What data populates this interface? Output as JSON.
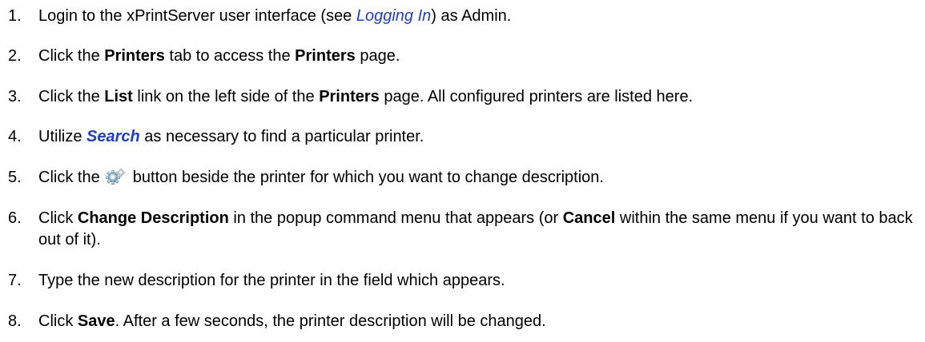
{
  "steps": [
    {
      "num": "1.",
      "t1": "Login to the xPrintServer user interface (see ",
      "link": "Logging In",
      "t2": ") as Admin."
    },
    {
      "num": "2.",
      "t1": "Click the ",
      "b1": "Printers",
      "t2": " tab to access the ",
      "b2": "Printers",
      "t3": " page."
    },
    {
      "num": "3.",
      "t1": "Click the ",
      "b1": "List",
      "t2": " link on the left side of the ",
      "b2": "Printers",
      "t3": " page. All configured printers are listed here."
    },
    {
      "num": "4.",
      "t1": "Utilize ",
      "link": "Search",
      "t2": " as necessary to find a particular printer."
    },
    {
      "num": "5.",
      "t1": "Click the ",
      "icon": "gear-icon",
      "t2": " button beside the printer for which you want to change description."
    },
    {
      "num": "6.",
      "t1": "Click ",
      "b1": "Change Description",
      "t2": " in the popup command menu that appears (or ",
      "b2": "Cancel",
      "t3": " within the same menu if you want to back out of it)."
    },
    {
      "num": "7.",
      "t1": "Type the new description for the printer in the field which appears."
    },
    {
      "num": "8.",
      "t1": "Click ",
      "b1": "Save",
      "t2": ".  After a few seconds, the printer description will be changed."
    }
  ],
  "colors": {
    "link": "#1a3fd6",
    "text": "#000000"
  }
}
